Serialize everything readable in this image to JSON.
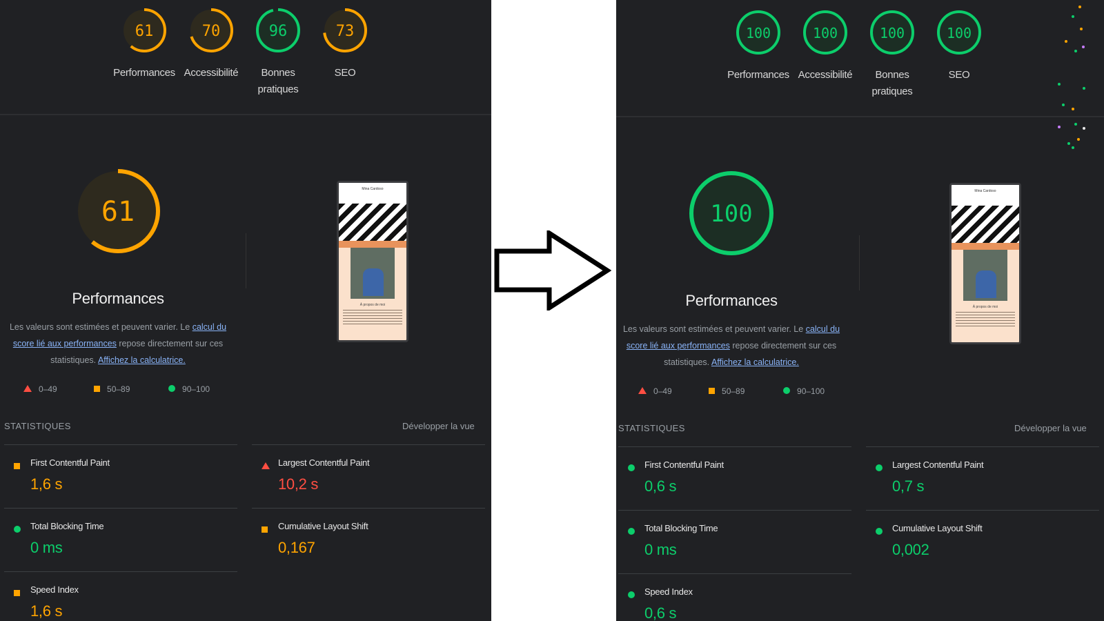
{
  "colors": {
    "fail": "#ff4e42",
    "average": "#ffa400",
    "pass": "#0cce6b",
    "bg": "#202124"
  },
  "before": {
    "gauges": [
      {
        "score": "61",
        "label": "Performances",
        "rating": "average"
      },
      {
        "score": "70",
        "label": "Accessibilité",
        "rating": "average"
      },
      {
        "score": "96",
        "label": "Bonnes pratiques",
        "rating": "pass"
      },
      {
        "score": "73",
        "label": "SEO",
        "rating": "average"
      }
    ],
    "main": {
      "score": "61",
      "title": "Performances",
      "rating": "average"
    },
    "description": {
      "text1": "Les valeurs sont estimées et peuvent varier. Le ",
      "link1": "calcul du score lié aux performances",
      "text2": " repose directement sur ces statistiques. ",
      "link2": "Affichez la calculatrice."
    },
    "legend": [
      "0–49",
      "50–89",
      "90–100"
    ],
    "stats_label": "STATISTIQUES",
    "expand_label": "Développer la vue",
    "thumbnail": {
      "header": "Mina Cardoso",
      "caption": "À propos de moi"
    },
    "metrics": [
      {
        "name": "First Contentful Paint",
        "value": "1,6 s",
        "rating": "average"
      },
      {
        "name": "Largest Contentful Paint",
        "value": "10,2 s",
        "rating": "fail"
      },
      {
        "name": "Total Blocking Time",
        "value": "0 ms",
        "rating": "pass"
      },
      {
        "name": "Cumulative Layout Shift",
        "value": "0,167",
        "rating": "average"
      },
      {
        "name": "Speed Index",
        "value": "1,6 s",
        "rating": "average"
      }
    ]
  },
  "after": {
    "gauges": [
      {
        "score": "100",
        "label": "Performances",
        "rating": "pass"
      },
      {
        "score": "100",
        "label": "Accessibilité",
        "rating": "pass"
      },
      {
        "score": "100",
        "label": "Bonnes pratiques",
        "rating": "pass"
      },
      {
        "score": "100",
        "label": "SEO",
        "rating": "pass"
      }
    ],
    "main": {
      "score": "100",
      "title": "Performances",
      "rating": "pass"
    },
    "description": {
      "text1": "Les valeurs sont estimées et peuvent varier. Le ",
      "link1": "calcul du score lié aux performances",
      "text2": " repose directement sur ces statistiques. ",
      "link2": "Affichez la calculatrice."
    },
    "legend": [
      "0–49",
      "50–89",
      "90–100"
    ],
    "stats_label": "STATISTIQUES",
    "expand_label": "Développer la vue",
    "thumbnail": {
      "header": "Mina Cardoso",
      "caption": "À propos de moi"
    },
    "metrics": [
      {
        "name": "First Contentful Paint",
        "value": "0,6 s",
        "rating": "pass"
      },
      {
        "name": "Largest Contentful Paint",
        "value": "0,7 s",
        "rating": "pass"
      },
      {
        "name": "Total Blocking Time",
        "value": "0 ms",
        "rating": "pass"
      },
      {
        "name": "Cumulative Layout Shift",
        "value": "0,002",
        "rating": "pass"
      },
      {
        "name": "Speed Index",
        "value": "0,6 s",
        "rating": "pass"
      }
    ]
  },
  "arrow": {
    "icon": "right-arrow-icon"
  }
}
